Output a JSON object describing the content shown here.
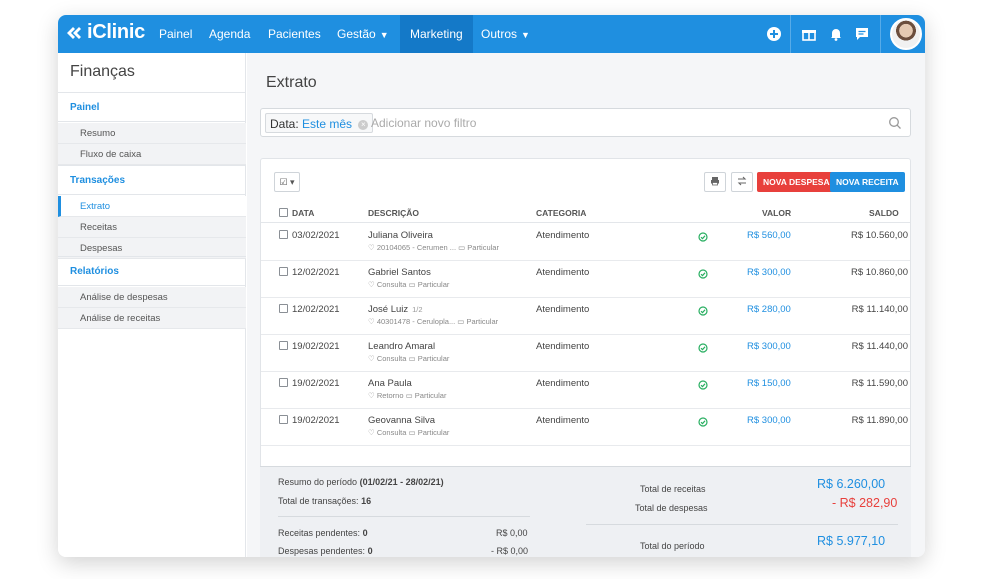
{
  "app": {
    "logo_text": "iClinic",
    "nav": [
      "Painel",
      "Agenda",
      "Pacientes",
      "Gestão",
      "Marketing",
      "Outros"
    ],
    "active_nav": "Marketing",
    "brand_color": "#1f8fe0"
  },
  "sidebar": {
    "title": "Finanças",
    "sections": [
      {
        "label": "Painel",
        "items": [
          "Resumo",
          "Fluxo de caixa"
        ]
      },
      {
        "label": "Transações",
        "items": [
          "Extrato",
          "Receitas",
          "Despesas"
        ]
      },
      {
        "label": "Relatórios",
        "items": [
          "Análise de despesas",
          "Análise de receitas"
        ]
      }
    ],
    "active_item": "Extrato"
  },
  "main": {
    "title": "Extrato",
    "filter": {
      "key": "Data:",
      "value": "Este mês",
      "placeholder": "Adicionar novo filtro"
    },
    "buttons": {
      "new_expense": "NOVA DESPESA",
      "new_income": "NOVA RECEITA"
    },
    "columns": [
      "DATA",
      "DESCRIÇÃO",
      "CATEGORIA",
      "VALOR",
      "SALDO"
    ],
    "rows": [
      {
        "date": "03/02/2021",
        "name": "Juliana Oliveira",
        "frac": "",
        "procedure": "20104065 - Cerumen ...",
        "payment": "Particular",
        "category": "Atendimento",
        "value": "R$ 560,00",
        "balance": "R$ 10.560,00"
      },
      {
        "date": "12/02/2021",
        "name": "Gabriel Santos",
        "frac": "",
        "procedure": "Consulta",
        "payment": "Particular",
        "category": "Atendimento",
        "value": "R$ 300,00",
        "balance": "R$ 10.860,00"
      },
      {
        "date": "12/02/2021",
        "name": "José Luiz",
        "frac": "1/2",
        "procedure": "40301478 - Ceruloplа...",
        "payment": "Particular",
        "category": "Atendimento",
        "value": "R$ 280,00",
        "balance": "R$ 11.140,00"
      },
      {
        "date": "19/02/2021",
        "name": "Leandro Amaral",
        "frac": "",
        "procedure": "Consulta",
        "payment": "Particular",
        "category": "Atendimento",
        "value": "R$ 300,00",
        "balance": "R$ 11.440,00"
      },
      {
        "date": "19/02/2021",
        "name": "Ana Paula",
        "frac": "",
        "procedure": "Retorno",
        "payment": "Particular",
        "category": "Atendimento",
        "value": "R$ 150,00",
        "balance": "R$ 11.590,00"
      },
      {
        "date": "19/02/2021",
        "name": "Geovanna Silva",
        "frac": "",
        "procedure": "Consulta",
        "payment": "Particular",
        "category": "Atendimento",
        "value": "R$ 300,00",
        "balance": "R$ 11.890,00"
      }
    ],
    "summary": {
      "period_label": "Resumo do período",
      "period_value": "(01/02/21 - 28/02/21)",
      "transactions_label": "Total de transações:",
      "transactions_value": "16",
      "pending_income_label": "Receitas pendentes:",
      "pending_income_count": "0",
      "pending_income_value": "R$ 0,00",
      "pending_expense_label": "Despesas pendentes:",
      "pending_expense_count": "0",
      "pending_expense_value": "- R$ 0,00",
      "total_income_label": "Total de receitas",
      "total_income_value": "R$ 6.260,00",
      "total_expense_label": "Total de despesas",
      "total_expense_value": "- R$ 282,90",
      "total_period_label": "Total do período",
      "total_period_value": "R$ 5.977,10"
    }
  }
}
